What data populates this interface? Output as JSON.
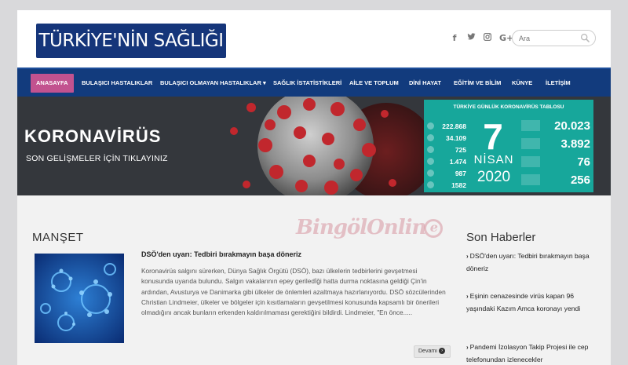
{
  "site": {
    "logo_text": "TÜRKİYE'NİN SAĞLIĞI",
    "socials": [
      {
        "icon": "facebook-icon",
        "glyph": "f"
      },
      {
        "icon": "twitter-icon",
        "glyph": "🐦"
      },
      {
        "icon": "instagram-icon",
        "glyph": "◙"
      },
      {
        "icon": "google-plus-icon",
        "glyph": "G+"
      }
    ],
    "search_placeholder": "Ara"
  },
  "nav": {
    "items": [
      {
        "label": "ANASAYFA",
        "active": true
      },
      {
        "label": "BULAŞICI HASTALIKLAR"
      },
      {
        "label": "BULAŞICI OLMAYAN HASTALIKLAR ▾"
      },
      {
        "label": "SAĞLIK İSTATİSTİKLERİ"
      },
      {
        "label": "AİLE VE TOPLUM"
      },
      {
        "label": "DİNİ HAYAT"
      },
      {
        "label": "EĞİTİM VE BİLİM"
      },
      {
        "label": "KÜNYE"
      },
      {
        "label": "İLETİŞİM"
      }
    ]
  },
  "banner": {
    "title": "KORONAVİRÜS",
    "subtitle": "SON GELİŞMELER İÇİN TIKLAYINIZ",
    "card": {
      "title": "TÜRKİYE GÜNLÜK KORONAVİRÜS TABLOSU",
      "left_values": [
        "222.868",
        "34.109",
        "725",
        "1.474",
        "987",
        "1582"
      ],
      "day": "7",
      "month": "NİSAN",
      "year": "2020",
      "right_values": [
        "20.023",
        "3.892",
        "76",
        "256"
      ]
    }
  },
  "manset": {
    "title": "MANŞET",
    "article_title": "DSÖ'den uyarı: Tedbiri bırakmayın başa döneriz",
    "excerpt": "Koronavirüs salgını sürerken, Dünya Sağlık Örgütü (DSÖ), bazı ülkelerin tedbirlerini gevşetmesi konusunda uyarıda bulundu. Salgın vakalarının epey geriledİği hatta durma noktasına geldiği Çin'in ardından, Avusturya ve Danimarka gibi ülkeler de önlemleri azaltmaya hazırlanıyordu. DSÖ sözcülerinden Christian Lindmeier, ülkeler ve bölgeler için kısıtlamaların gevşetilmesi konusunda kapsamlı bir önerileri olmadığını ancak bunların erkenden kaldırılmaması gerektiğini bildirdi. Lindmeier, \"En önce.....",
    "more_label": "Devamı"
  },
  "watermark": {
    "text": "BingölOnlin",
    "tail": "e"
  },
  "son_haberler": {
    "title": "Son Haberler",
    "items": [
      "DSÖ'den uyarı: Tedbiri bırakmayın başa döneriz",
      "Eşinin cenazesinde virüs kapan 96 yaşındaki Kazım Amca koronayı yendi",
      "Pandemi İzolasyon Takip Projesi ile cep telefonundan izlenecekler"
    ]
  },
  "colors": {
    "nav_bg": "#123b7d",
    "active_tab": "#c2528f",
    "logo_bg": "#15357a",
    "covid_card": "#17a79b"
  }
}
